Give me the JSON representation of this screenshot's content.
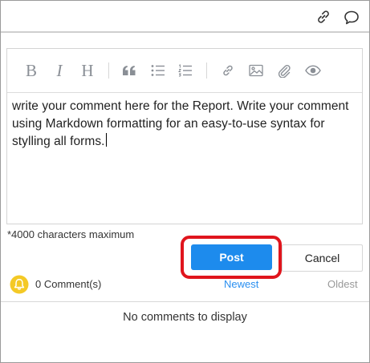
{
  "header": {
    "link_icon": "link-icon",
    "comment_icon": "speech-bubble-icon"
  },
  "editor": {
    "toolbar": {
      "bold_label": "B",
      "italic_label": "I",
      "heading_label": "H",
      "icons": [
        "bold-icon",
        "italic-icon",
        "heading-icon",
        "quote-icon",
        "bulleted-list-icon",
        "numbered-list-icon",
        "link-icon",
        "image-icon",
        "attachment-icon",
        "preview-eye-icon"
      ]
    },
    "text": "write your comment here for the Report. Write your comment using Markdown formatting for an easy-to-use syntax for stylling all forms."
  },
  "limit_note": "*4000 characters maximum",
  "actions": {
    "post_label": "Post",
    "cancel_label": "Cancel",
    "highlight_color": "#e0151d",
    "post_color": "#1d8bed"
  },
  "comments": {
    "count_label": "0 Comment(s)",
    "sort_newest": "Newest",
    "sort_oldest": "Oldest",
    "empty_message": "No comments to display"
  }
}
